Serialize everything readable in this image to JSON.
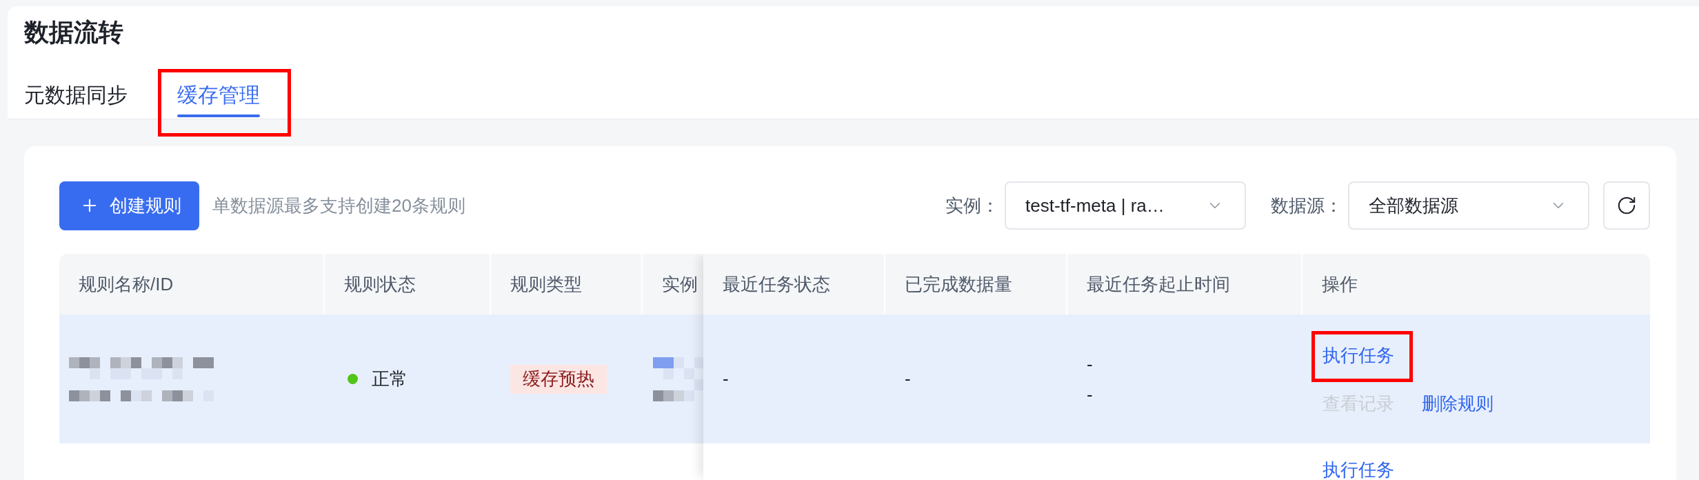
{
  "page": {
    "title": "数据流转"
  },
  "tabs": [
    {
      "label": "元数据同步",
      "selected": false,
      "highlighted": false
    },
    {
      "label": "缓存管理",
      "selected": true,
      "highlighted": true
    }
  ],
  "toolbar": {
    "create_button": {
      "label": "创建规则"
    },
    "hint": "单数据源最多支持创建20条规则",
    "filters": [
      {
        "label": "实例：",
        "value": "test-tf-meta | ra…"
      },
      {
        "label": "数据源：",
        "value": "全部数据源"
      }
    ]
  },
  "table": {
    "columns": [
      "规则名称/ID",
      "规则状态",
      "规则类型",
      "实例",
      "最近任务状态",
      "已完成数据量",
      "最近任务起止时间",
      "操作"
    ],
    "rows": [
      {
        "selected": true,
        "redacted": true,
        "status": {
          "label": "正常",
          "color": "#52c41a"
        },
        "type": "缓存预热",
        "last_task_status": "-",
        "completed_count": "-",
        "task_time": [
          "-",
          "-"
        ],
        "actions": [
          {
            "label": "执行任务",
            "disabled": false,
            "highlighted": true
          },
          {
            "label": "查看记录",
            "disabled": true,
            "highlighted": false
          },
          {
            "label": "删除规则",
            "disabled": false,
            "highlighted": false
          }
        ]
      },
      {
        "selected": false,
        "actions": [
          {
            "label": "执行任务",
            "disabled": false,
            "highlighted": false
          }
        ]
      }
    ]
  }
}
